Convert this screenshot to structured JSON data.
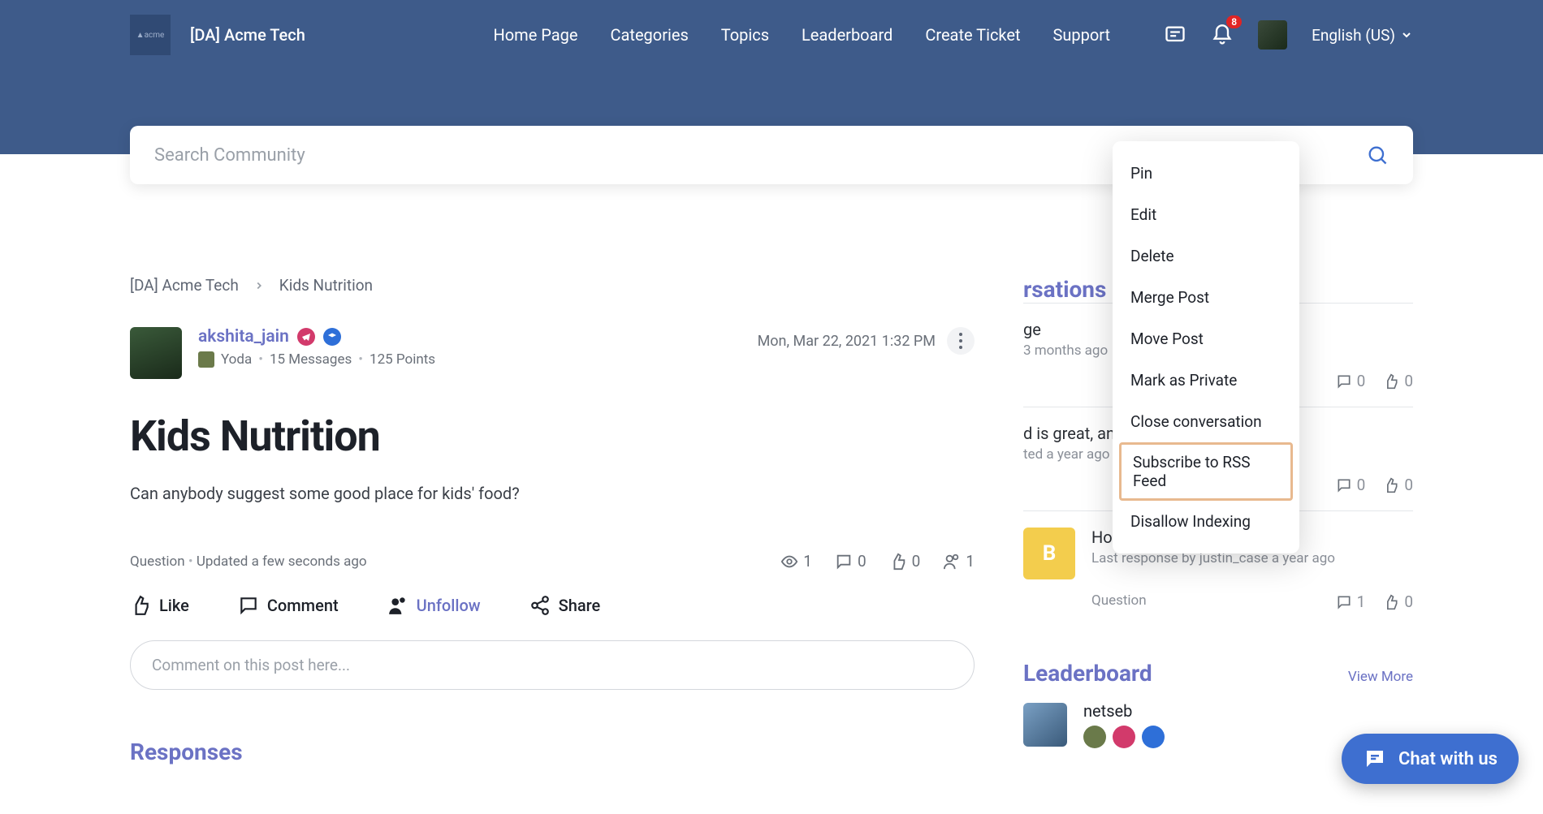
{
  "header": {
    "brand": "[DA] Acme Tech",
    "nav": [
      "Home Page",
      "Categories",
      "Topics",
      "Leaderboard",
      "Create Ticket",
      "Support"
    ],
    "badge_count": "8",
    "language": "English (US)"
  },
  "search": {
    "placeholder": "Search Community"
  },
  "breadcrumb": [
    "[DA] Acme Tech",
    "Kids Nutrition"
  ],
  "author": {
    "name": "akshita_jain",
    "rank": "Yoda",
    "messages": "15 Messages",
    "points": "125 Points"
  },
  "post": {
    "timestamp": "Mon, Mar 22, 2021 1:32 PM",
    "title": "Kids Nutrition",
    "body": "Can anybody suggest some good place for kids' food?",
    "tag": "Question",
    "updated": "Updated a few seconds ago",
    "stats": {
      "views": "1",
      "comments": "0",
      "likes": "0",
      "followers": "1"
    }
  },
  "actions": {
    "like": "Like",
    "comment": "Comment",
    "unfollow": "Unfollow",
    "share": "Share"
  },
  "comment_placeholder": "Comment on this post here...",
  "responses_title": "Responses",
  "dropdown": [
    "Pin",
    "Edit",
    "Delete",
    "Merge Post",
    "Move Post",
    "Mark as Private",
    "Close conversation",
    "Subscribe to RSS Feed",
    "Disallow Indexing"
  ],
  "dropdown_highlight_index": 7,
  "side": {
    "conversations_title": "rsations",
    "convos": [
      {
        "title": "ge",
        "sub": "3 months ago",
        "comments": "0",
        "likes": "0"
      },
      {
        "title": "d is great, and even though it doe…",
        "sub": "ted a year ago",
        "comments": "0",
        "likes": "0"
      },
      {
        "title": "How do I use Facebook?",
        "sub": "Last response by justin_case a year ago",
        "tag": "Question",
        "comments": "1",
        "likes": "0",
        "avatar_letter": "B"
      }
    ],
    "leaderboard_title": "Leaderboard",
    "view_more": "View More",
    "leaders": [
      {
        "name": "netseb"
      }
    ]
  },
  "chat_label": "Chat with us"
}
